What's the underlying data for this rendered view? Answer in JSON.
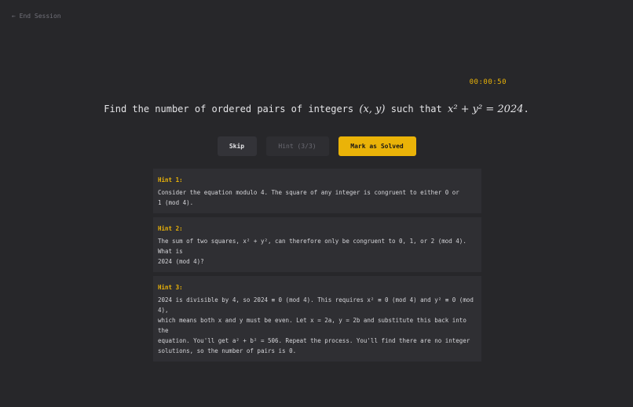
{
  "nav": {
    "end_session": "← End Session"
  },
  "timer": "00:00:50",
  "problem": {
    "prefix": "Find the number of ordered pairs of integers",
    "pair": "(x, y)",
    "middle": "such that",
    "equation": "x² + y² = 2024",
    "suffix": "."
  },
  "buttons": {
    "skip": "Skip",
    "hint": "Hint (3/3)",
    "mark_solved": "Mark as Solved"
  },
  "hints": [
    {
      "title": "Hint 1:",
      "line1": "Consider the equation modulo 4. The square of any integer is congruent to either 0 or",
      "line2": "1 (mod 4)."
    },
    {
      "title": "Hint 2:",
      "line1": "The sum of two squares, x² + y², can therefore only be congruent to 0, 1, or 2 (mod 4). What is",
      "line2": "2024 (mod 4)?"
    },
    {
      "title": "Hint 3:",
      "line1": "2024 is divisible by 4, so 2024 ≡ 0 (mod 4). This requires x² ≡ 0 (mod 4) and y² ≡ 0 (mod 4),",
      "line2": "which means both x and y must be even. Let x = 2a, y = 2b and substitute this back into the",
      "line3": "equation. You'll get a² + b² = 506. Repeat the process. You'll find there are no integer",
      "line4": "solutions, so the number of pairs is 0."
    }
  ],
  "colors": {
    "accent": "#eab308",
    "background": "#27272a",
    "card": "#2f2f33"
  }
}
